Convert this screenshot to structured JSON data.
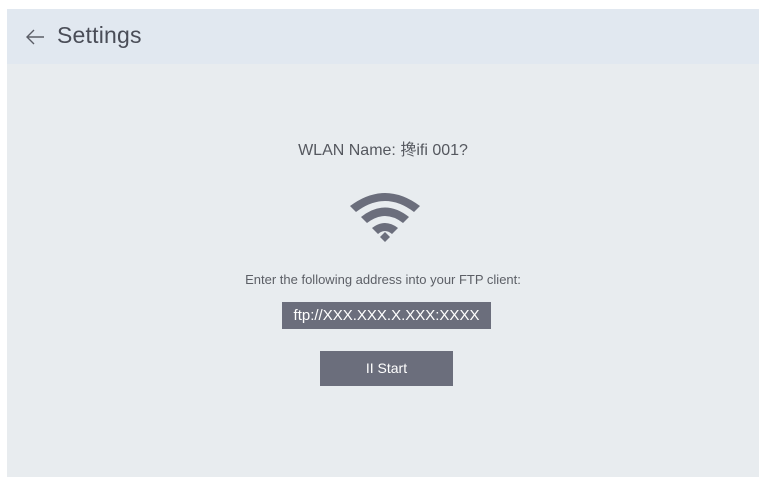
{
  "header": {
    "back_icon": "arrow-left-icon",
    "title": "Settings"
  },
  "main": {
    "wlan_name": "WLAN Name: 搀ifi 001?",
    "wifi_icon": "wifi-icon",
    "instruction": "Enter the following address into your FTP client:",
    "ftp_address": "ftp://XXX.XXX.X.XXX:XXXX",
    "start_label": "II Start"
  },
  "colors": {
    "header_bg": "#e1e8f0",
    "body_bg": "#e8ecef",
    "accent": "#6b6e7c",
    "text": "#55585f"
  }
}
